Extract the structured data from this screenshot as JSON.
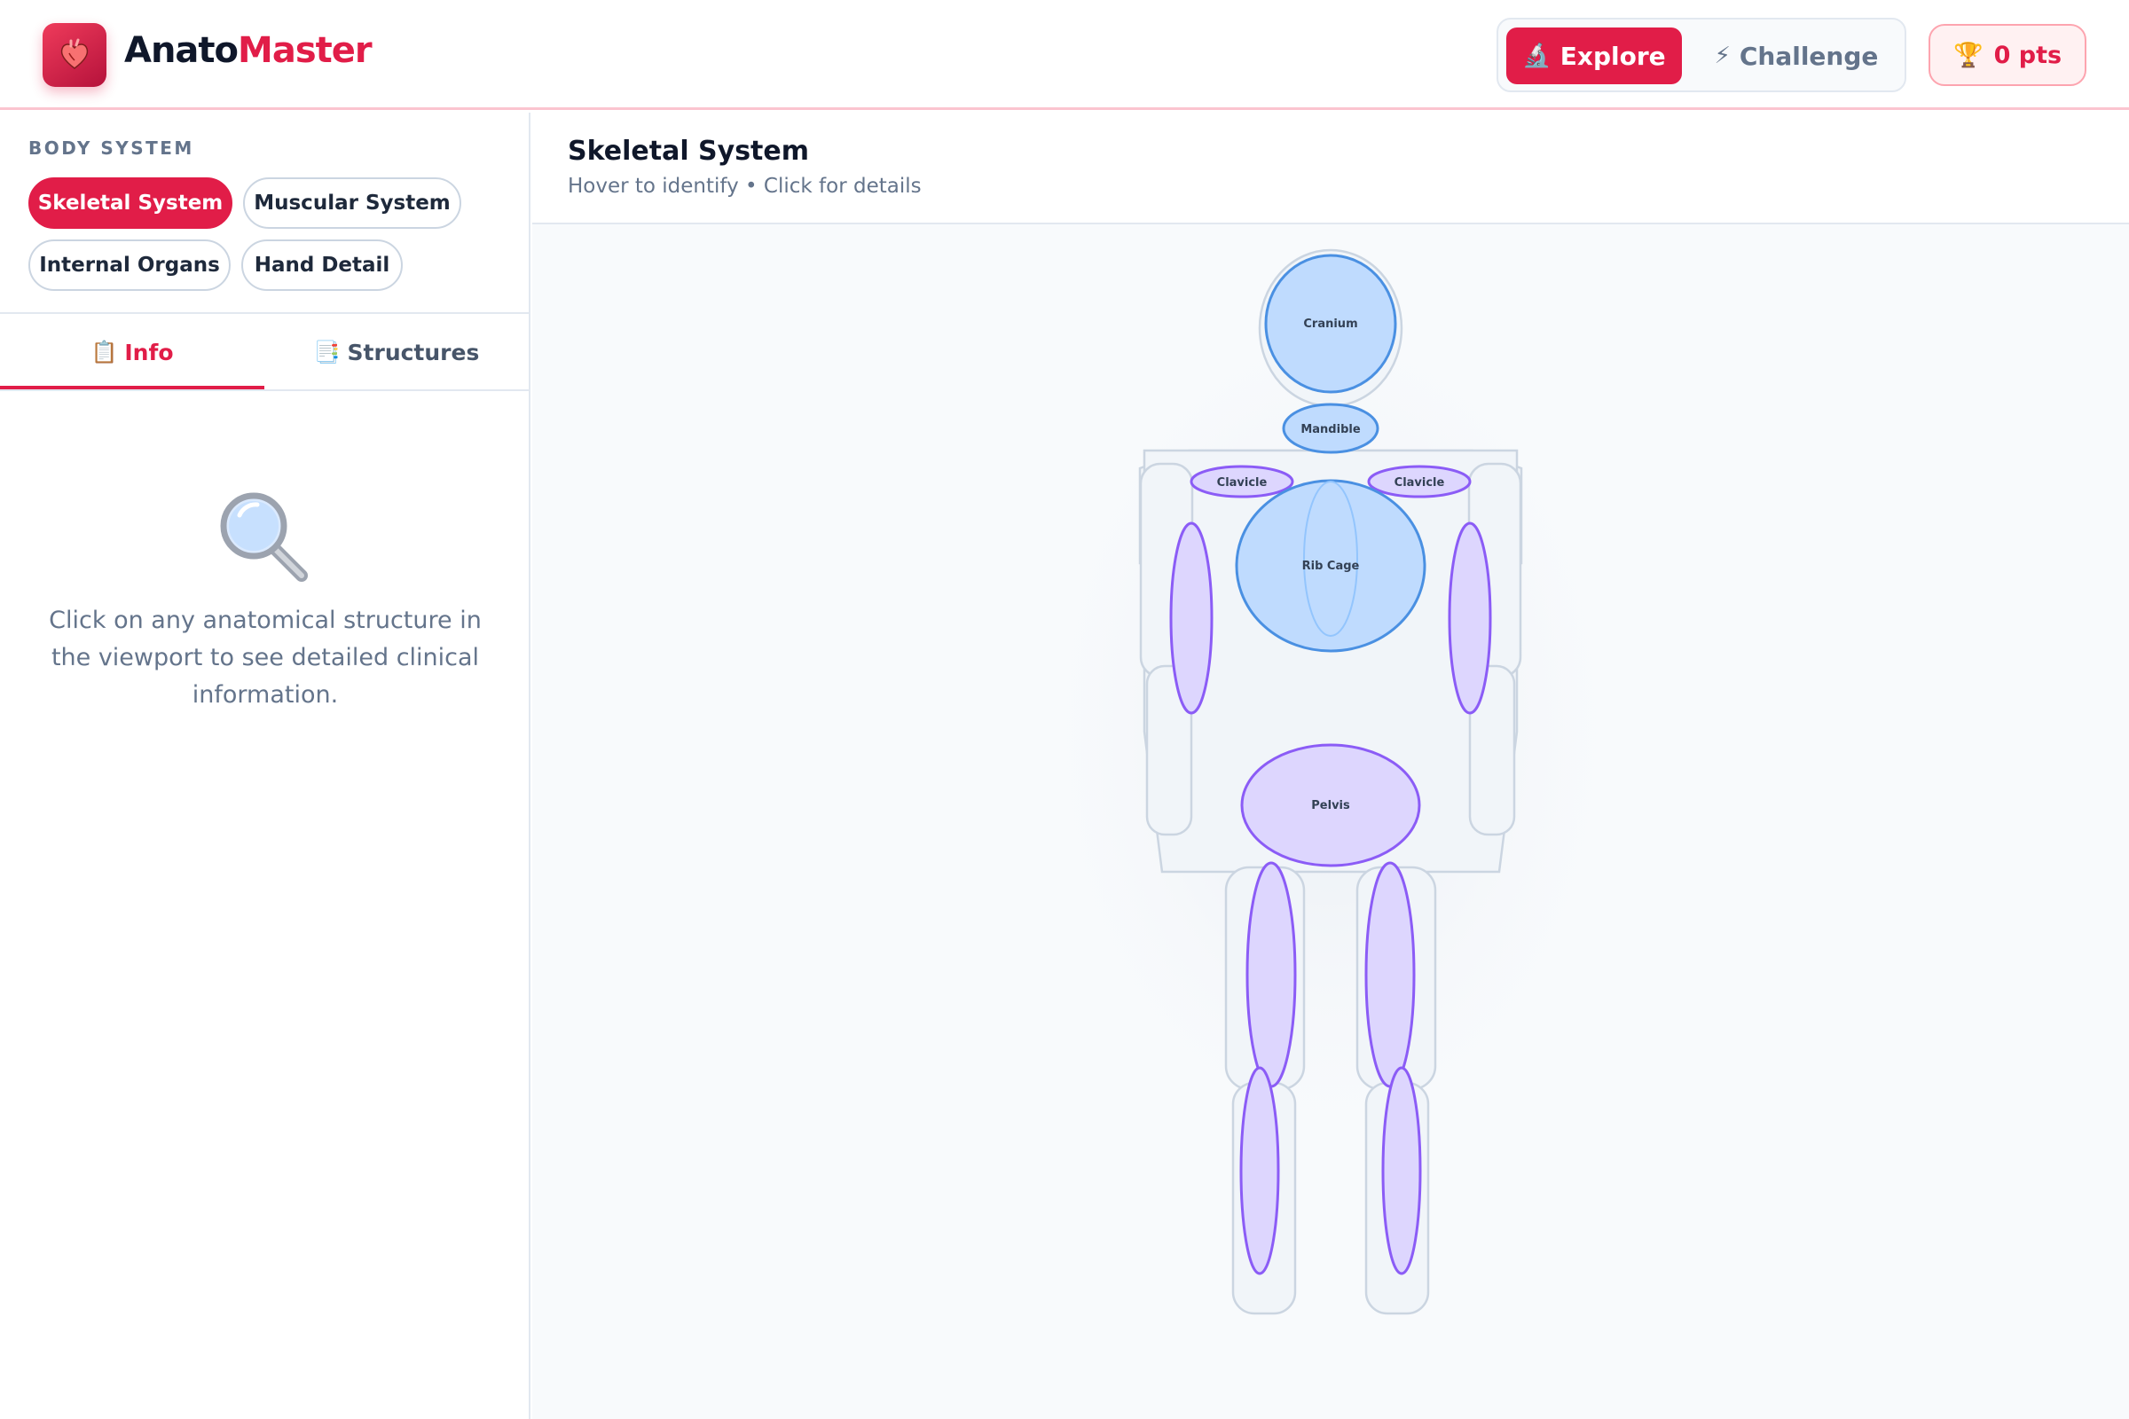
{
  "app": {
    "name_prefix": "Anato",
    "name_accent": "Master",
    "logo_icon": "anatomical-heart-icon"
  },
  "header": {
    "modes": [
      {
        "label": "Explore",
        "icon": "microscope-icon",
        "glyph": "🔬",
        "active": true
      },
      {
        "label": "Challenge",
        "icon": "lightning-icon",
        "glyph": "⚡",
        "active": false
      }
    ],
    "points": {
      "label": "0 pts",
      "icon": "trophy-icon",
      "glyph": "🏆"
    }
  },
  "sidebar": {
    "section_label": "BODY SYSTEM",
    "systems": [
      {
        "label": "Skeletal System",
        "active": true
      },
      {
        "label": "Muscular System",
        "active": false
      },
      {
        "label": "Internal Organs",
        "active": false
      },
      {
        "label": "Hand Detail",
        "active": false
      }
    ],
    "tabs": [
      {
        "label": "Info",
        "icon": "clipboard-icon",
        "glyph": "📋",
        "active": true
      },
      {
        "label": "Structures",
        "icon": "list-icon",
        "glyph": "📑",
        "active": false
      }
    ],
    "empty_state": {
      "icon": "magnifier-icon",
      "text": "Click on any anatomical structure in the viewport to see detailed clinical information."
    }
  },
  "main": {
    "title": "Skeletal System",
    "subtitle": "Hover to identify • Click for details"
  },
  "structures": {
    "cranium": "Cranium",
    "mandible": "Mandible",
    "clavicle_left": "Clavicle",
    "clavicle_right": "Clavicle",
    "rib_cage": "Rib Cage",
    "pelvis": "Pelvis"
  },
  "colors": {
    "accent": "#e11d48",
    "bone_blue_fill": "#bfdbfe",
    "bone_blue_stroke": "#4a90e2",
    "bone_purple_fill": "#ddd6fe",
    "bone_purple_stroke": "#8b5cf6",
    "body_outline": "#cbd5e1"
  }
}
